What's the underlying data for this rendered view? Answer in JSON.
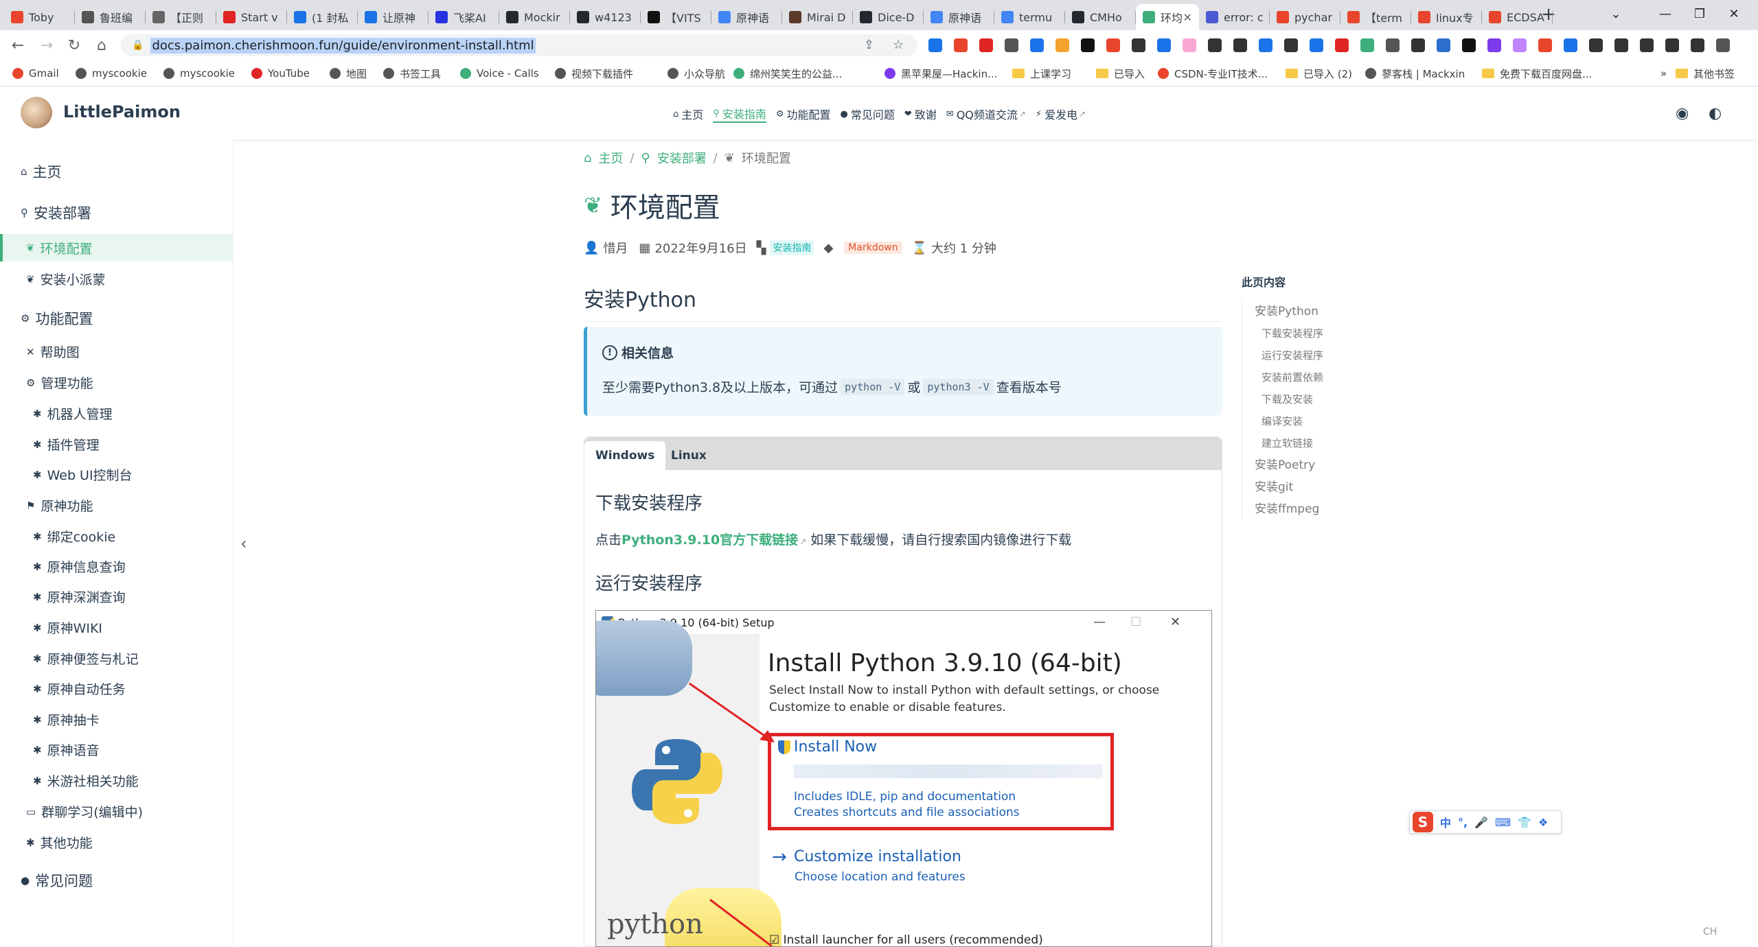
{
  "browser": {
    "tabs": [
      {
        "label": "Toby",
        "color": "#e8452c"
      },
      {
        "label": "鲁班编",
        "color": "#555555"
      },
      {
        "label": "【正则",
        "color": "#666666"
      },
      {
        "label": "Start v",
        "color": "#e02424"
      },
      {
        "label": "(1 封私",
        "color": "#1a73e8"
      },
      {
        "label": "让原神",
        "color": "#1a73e8"
      },
      {
        "label": "飞桨AI",
        "color": "#2932e1"
      },
      {
        "label": "Mockir",
        "color": "#24292f"
      },
      {
        "label": "w4123",
        "color": "#24292f"
      },
      {
        "label": "【VITS",
        "color": "#111111"
      },
      {
        "label": "原神语",
        "color": "#4285f4"
      },
      {
        "label": "Mirai D",
        "color": "#5b3a2a"
      },
      {
        "label": "Dice-D",
        "color": "#24292f"
      },
      {
        "label": "原神语",
        "color": "#4285f4"
      },
      {
        "label": "termu",
        "color": "#4285f4"
      },
      {
        "label": "CMHo",
        "color": "#24292f"
      },
      {
        "label": "环均",
        "color": "#3eaf7c",
        "active": true
      },
      {
        "label": "error: c",
        "color": "#4c5bd4"
      },
      {
        "label": "pychar",
        "color": "#e8452c"
      },
      {
        "label": "【term",
        "color": "#e8452c"
      },
      {
        "label": "linux专",
        "color": "#e8452c"
      },
      {
        "label": "ECDSA",
        "color": "#e8452c"
      }
    ],
    "url": "docs.paimon.cherishmoon.fun/guide/environment-install.html",
    "bookmarks": [
      "Gmail",
      "myscookie",
      "myscookie",
      "YouTube",
      "地图",
      "书签工具",
      "Voice - Calls",
      "视频下载插件",
      "小众导航",
      "绵州笑笑生的公益...",
      "黑苹果屋—Hackin...",
      "上课学习",
      "已导入",
      "CSDN-专业IT技术...",
      "已导入 (2)",
      "蓼客栈 | Mackxin",
      "免费下载百度网盘...",
      "其他书签"
    ],
    "colors": {
      "accent": "#3eaf7c",
      "tabbar": "#dfe1e5"
    }
  },
  "site": {
    "brand": "LittlePaimon",
    "nav": [
      {
        "label": "主页",
        "icon": "home-icon"
      },
      {
        "label": "安装指南",
        "icon": "pin-icon",
        "active": true
      },
      {
        "label": "功能配置",
        "icon": "config-icon"
      },
      {
        "label": "常见问题",
        "icon": "info-icon"
      },
      {
        "label": "致谢",
        "icon": "heart-icon"
      },
      {
        "label": "QQ频道交流",
        "icon": "qq-icon",
        "external": true
      },
      {
        "label": "爱发电",
        "icon": "charge-icon",
        "external": true
      }
    ]
  },
  "sidebar": {
    "home": "主页",
    "install": "安装部署",
    "env": "环境配置",
    "paimon": "安装小派蒙",
    "features": "功能配置",
    "help": "帮助图",
    "manage": "管理功能",
    "bot": "机器人管理",
    "plugin": "插件管理",
    "webui": "Web UI控制台",
    "genshin": "原神功能",
    "cookie": "绑定cookie",
    "info": "原神信息查询",
    "abyss": "原神深渊查询",
    "wiki": "原神WIKI",
    "sign": "原神便签与札记",
    "auto": "原神自动任务",
    "gacha": "原神抽卡",
    "voice": "原神语音",
    "mys": "米游社相关功能",
    "chat": "群聊学习(编辑中)",
    "other": "其他功能",
    "faq": "常见问题"
  },
  "page": {
    "breadcrumb": [
      "主页",
      "安装部署",
      "环境配置"
    ],
    "title": "环境配置",
    "author": "惜月",
    "date": "2022年9月16日",
    "category": "安装指南",
    "tag": "Markdown",
    "readtime": "大约 1 分钟",
    "section": "安装Python",
    "callout": {
      "title": "相关信息",
      "pre": "至少需要Python3.8及以上版本，可通过",
      "code1": "python -V",
      "mid": "或",
      "code2": "python3 -V",
      "post": "查看版本号"
    },
    "tabs": [
      "Windows",
      "Linux"
    ],
    "download_heading": "下载安装程序",
    "download_pre": "点击",
    "download_link": "Python3.9.10官方下载链接",
    "download_post": "如果下载缓慢，请自行搜索国内镜像进行下载",
    "run_heading": "运行安装程序"
  },
  "installer": {
    "window_title": "Python 3.9.10 (64-bit) Setup",
    "heading": "Install Python 3.9.10 (64-bit)",
    "sub1": "Select Install Now to install Python with default settings, or choose",
    "sub2": "Customize to enable or disable features.",
    "install_now": "Install Now",
    "install_desc1": "Includes IDLE, pip and documentation",
    "install_desc2": "Creates shortcuts and file associations",
    "customize": "Customize installation",
    "customize_desc": "Choose location and features",
    "launcher": "Install launcher for all users (recommended)",
    "logo_word": "python"
  },
  "toc": {
    "title": "此页内容",
    "items": [
      {
        "label": "安装Python",
        "level": 1
      },
      {
        "label": "下载安装程序",
        "level": 2
      },
      {
        "label": "运行安装程序",
        "level": 2
      },
      {
        "label": "安装前置依赖",
        "level": 2
      },
      {
        "label": "下载及安装",
        "level": 2
      },
      {
        "label": "编译安装",
        "level": 2
      },
      {
        "label": "建立软链接",
        "level": 2
      },
      {
        "label": "安装Poetry",
        "level": 1
      },
      {
        "label": "安装git",
        "level": 1
      },
      {
        "label": "安装ffmpeg",
        "level": 1
      }
    ]
  },
  "ime": {
    "mode": "中",
    "punct": "°,",
    "corner": "CH"
  }
}
